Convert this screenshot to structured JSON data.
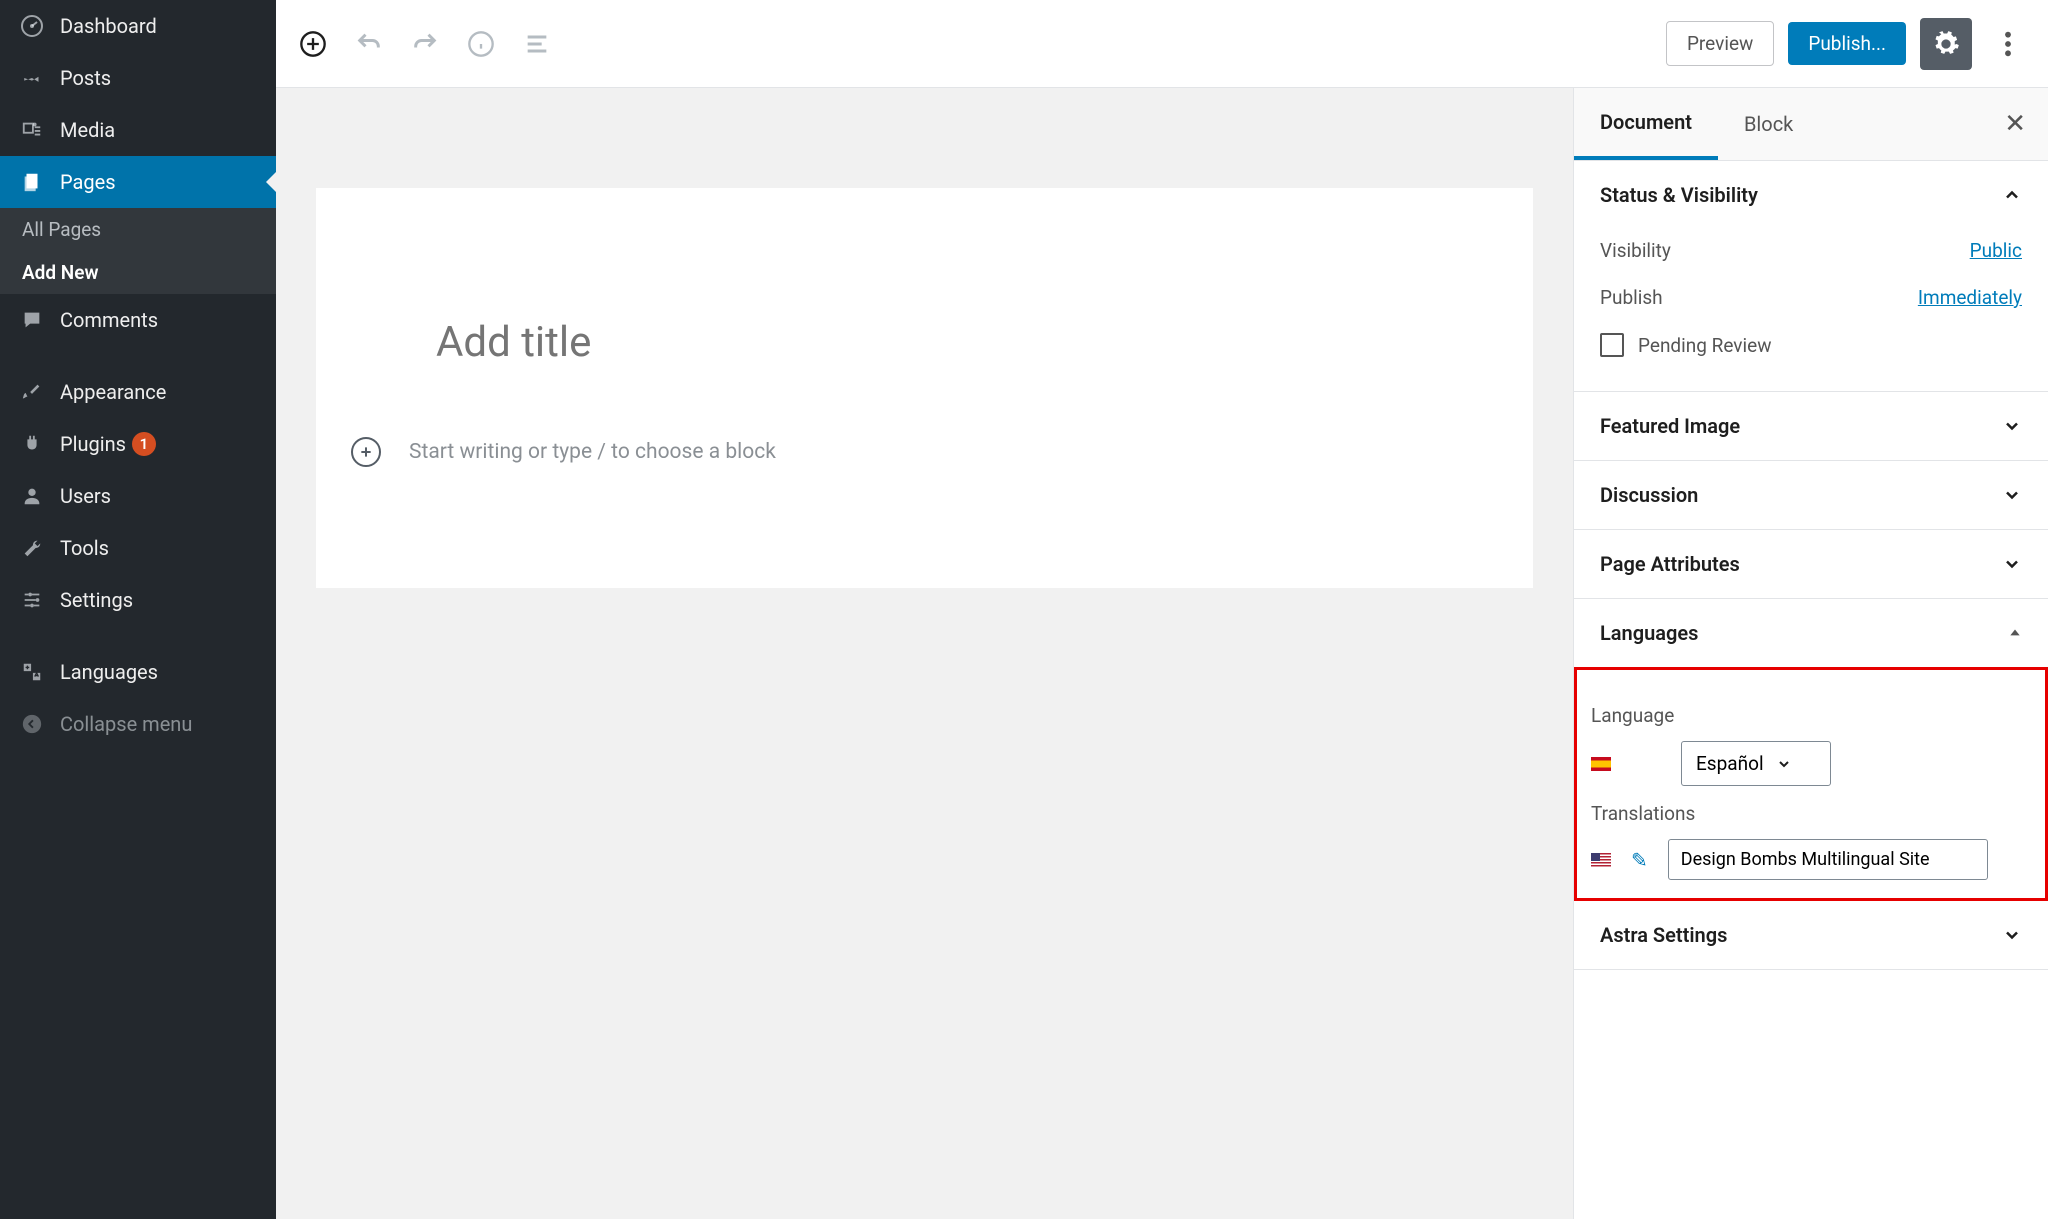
{
  "sidebar": {
    "items": [
      {
        "label": "Dashboard"
      },
      {
        "label": "Posts"
      },
      {
        "label": "Media"
      },
      {
        "label": "Pages"
      },
      {
        "label": "Comments"
      },
      {
        "label": "Appearance"
      },
      {
        "label": "Plugins",
        "badge": "1"
      },
      {
        "label": "Users"
      },
      {
        "label": "Tools"
      },
      {
        "label": "Settings"
      },
      {
        "label": "Languages"
      },
      {
        "label": "Collapse menu"
      }
    ],
    "sub": {
      "all": "All Pages",
      "addnew": "Add New"
    }
  },
  "topbar": {
    "preview": "Preview",
    "publish": "Publish..."
  },
  "editor": {
    "title_placeholder": "Add title",
    "block_placeholder": "Start writing or type / to choose a block"
  },
  "doc": {
    "tabs": {
      "document": "Document",
      "block": "Block"
    },
    "panels": {
      "status": {
        "title": "Status & Visibility",
        "visibility_label": "Visibility",
        "visibility_value": "Public",
        "publish_label": "Publish",
        "publish_value": "Immediately",
        "pending": "Pending Review"
      },
      "featured": "Featured Image",
      "discussion": "Discussion",
      "page_attr": "Page Attributes",
      "languages": {
        "title": "Languages",
        "language_label": "Language",
        "selected": "Español",
        "translations_label": "Translations",
        "translation_value": "Design Bombs Multilingual Site"
      },
      "astra": "Astra Settings"
    }
  }
}
